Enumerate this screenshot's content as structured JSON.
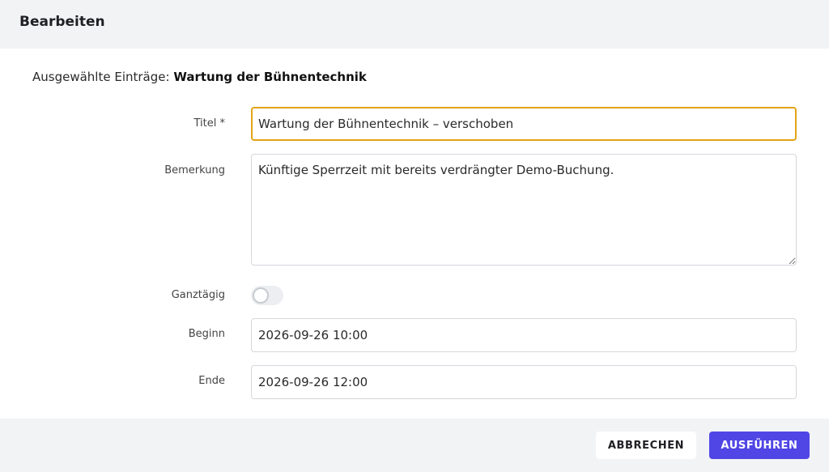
{
  "dialog": {
    "title": "Bearbeiten"
  },
  "selection": {
    "label": "Ausgewählte Einträge:",
    "value": "Wartung der Bühnentechnik"
  },
  "form": {
    "title_label": "Titel *",
    "title_value": "Wartung der Bühnentechnik – verschoben",
    "remark_label": "Bemerkung",
    "remark_value": "Künftige Sperrzeit mit bereits verdrängter Demo-Buchung.",
    "allday_label": "Ganztägig",
    "allday_on": false,
    "start_label": "Beginn",
    "start_value": "2026-09-26 10:00",
    "end_label": "Ende",
    "end_value": "2026-09-26 12:00"
  },
  "actions": {
    "cancel_label": "ABBRECHEN",
    "run_label": "AUSFÜHREN"
  },
  "colors": {
    "focus_border": "#e3a317",
    "primary": "#5046e5"
  }
}
